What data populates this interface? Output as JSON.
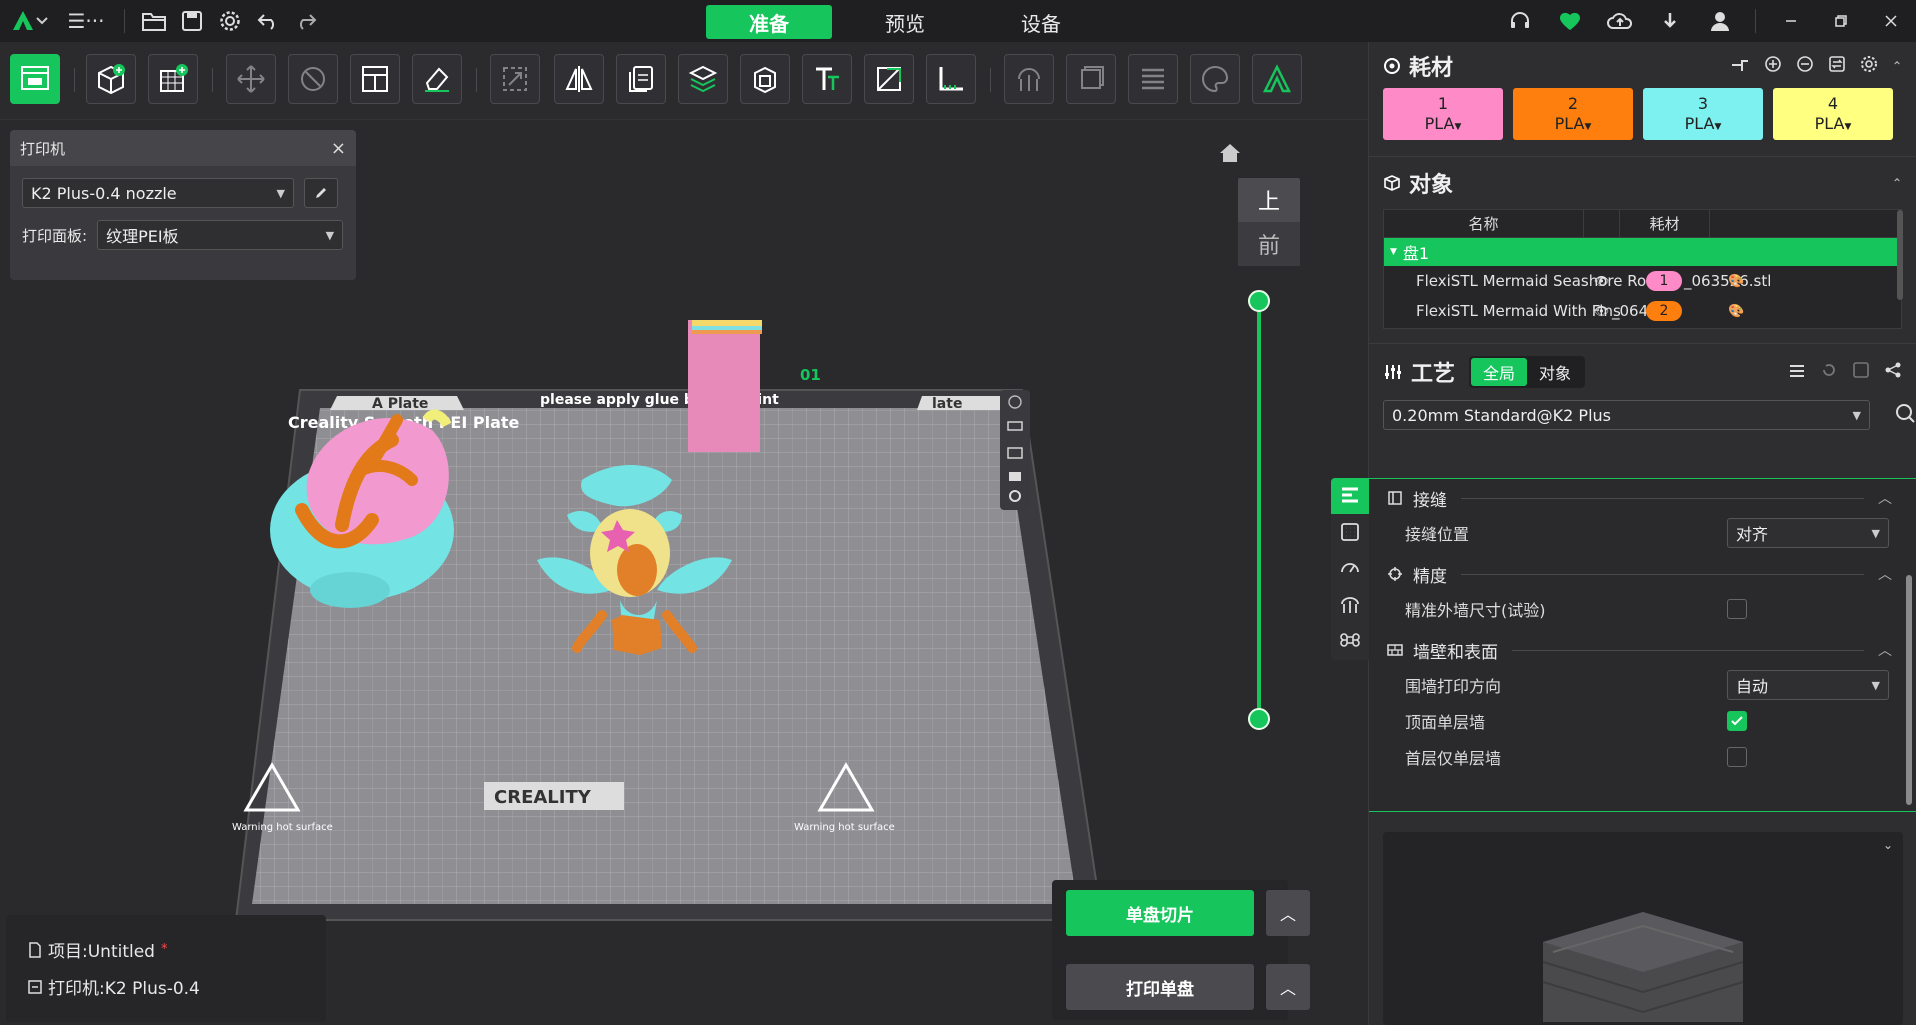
{
  "titlebar": {
    "tabs": [
      {
        "label": "准备",
        "active": true
      },
      {
        "label": "预览",
        "active": false
      },
      {
        "label": "设备",
        "active": false
      }
    ],
    "menu_label": "☰···"
  },
  "printer_panel": {
    "title": "打印机",
    "printer_value": "K2 Plus-0.4 nozzle",
    "plate_label": "打印面板:",
    "plate_value": "纹理PEI板"
  },
  "plate": {
    "brand": "Creality Smooth PEI Plate",
    "tab_a": "A Plate",
    "glue_note": "please apply glue before print",
    "tab_b": "late",
    "plate_number": "01",
    "logo": "CREALITY",
    "warning_left": "Warning hot surface",
    "warning_right": "Warning hot surface"
  },
  "view_cube": {
    "top": "上",
    "front": "前"
  },
  "project": {
    "project_label": "项目:Untitled",
    "modified_mark": "*",
    "printer_label": "打印机:K2 Plus-0.4"
  },
  "slice": {
    "slice_label": "单盘切片",
    "print_label": "打印单盘"
  },
  "filament": {
    "title": "耗材",
    "items": [
      {
        "num": "1",
        "type": "PLA",
        "color": "#ff8ac8"
      },
      {
        "num": "2",
        "type": "PLA",
        "color": "#ff7f0e"
      },
      {
        "num": "3",
        "type": "PLA",
        "color": "#7df0f0"
      },
      {
        "num": "4",
        "type": "PLA",
        "color": "#ffff80"
      }
    ]
  },
  "objects": {
    "title": "对象",
    "col_name": "名称",
    "col_filament": "耗材",
    "plate_row": "盘1",
    "rows": [
      {
        "name": "FlexiSTL Mermaid Seashore Rock",
        "badge": "1",
        "suffix": "_063526.stl",
        "badge_color": "#ff8ac8"
      },
      {
        "name": "FlexiSTL Mermaid With Fins",
        "badge": "2",
        "suffix": "_06415",
        "badge_color": "#ff7f0e"
      }
    ]
  },
  "process": {
    "title": "工艺",
    "toggle_global": "全局",
    "toggle_object": "对象",
    "preset": "0.20mm Standard@K2 Plus"
  },
  "settings": {
    "groups": [
      {
        "title": "接缝",
        "options": [
          {
            "label": "接缝位置",
            "type": "select",
            "value": "对齐"
          }
        ]
      },
      {
        "title": "精度",
        "options": [
          {
            "label": "精准外墙尺寸(试验)",
            "type": "checkbox",
            "checked": false
          }
        ]
      },
      {
        "title": "墙壁和表面",
        "options": [
          {
            "label": "围墙打印方向",
            "type": "select",
            "value": "自动"
          },
          {
            "label": "顶面单层墙",
            "type": "checkbox",
            "checked": true
          },
          {
            "label": "首层仅单层墙",
            "type": "checkbox",
            "checked": false
          }
        ]
      }
    ]
  },
  "colors": {
    "accent": "#16c55c"
  }
}
